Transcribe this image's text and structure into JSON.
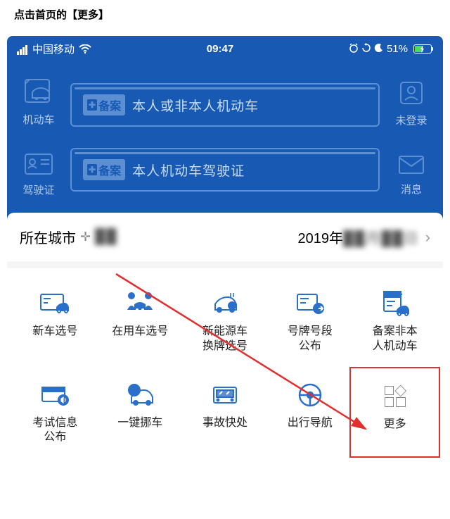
{
  "instruction": "点击首页的【更多】",
  "status": {
    "carrier": "中国移动",
    "time": "09:47",
    "battery_pct": "51%"
  },
  "hero": {
    "left_top": "机动车",
    "left_bottom": "驾驶证",
    "right_top": "未登录",
    "right_bottom": "消息",
    "banner1_badge": "备案",
    "banner1_text": "本人或非本人机动车",
    "banner2_badge": "备案",
    "banner2_text": "本人机动车驾驶证"
  },
  "city_bar": {
    "label": "所在城市",
    "city_value": "██",
    "date_prefix": "2019年",
    "date_rest": "██月██日"
  },
  "grid": [
    {
      "label": "新车选号"
    },
    {
      "label": "在用车选号"
    },
    {
      "label": "新能源车\n换牌选号"
    },
    {
      "label": "号牌号段\n公布"
    },
    {
      "label": "备案非本\n人机动车"
    },
    {
      "label": "考试信息\n公布"
    },
    {
      "label": "一键挪车"
    },
    {
      "label": "事故快处"
    },
    {
      "label": "出行导航"
    },
    {
      "label": "更多"
    }
  ]
}
